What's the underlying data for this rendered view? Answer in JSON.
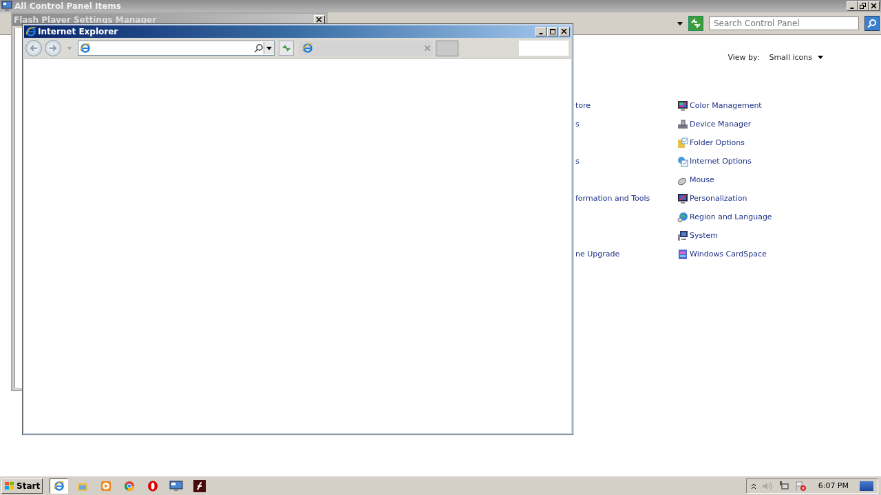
{
  "control_panel": {
    "title": "All Control Panel Items",
    "search": {
      "placeholder": "Search Control Panel"
    },
    "view_by": {
      "label": "View by:",
      "value": "Small icons"
    },
    "rows": [
      {
        "left": "tore",
        "right": {
          "label": "Color Management",
          "kind": "color"
        }
      },
      {
        "left": "s",
        "right": {
          "label": "Device Manager",
          "kind": "device"
        }
      },
      {
        "right": {
          "label": "Folder Options",
          "kind": "folder"
        }
      },
      {
        "left": "s",
        "right": {
          "label": "Internet Options",
          "kind": "internet"
        }
      },
      {
        "right": {
          "label": "Mouse",
          "kind": "mouse"
        }
      },
      {
        "left": "formation and Tools",
        "right": {
          "label": "Personalization",
          "kind": "personalization"
        }
      },
      {
        "right": {
          "label": "Region and Language",
          "kind": "region"
        }
      },
      {
        "right": {
          "label": "System",
          "kind": "system"
        }
      },
      {
        "left": "ne Upgrade",
        "right": {
          "label": "Windows CardSpace",
          "kind": "cardspace"
        }
      }
    ]
  },
  "flash_window": {
    "title": "Flash Player Settings Manager"
  },
  "ie_window": {
    "title": "Internet Explorer"
  },
  "taskbar": {
    "start": "Start",
    "buttons": [
      {
        "kind": "ie",
        "selected": true
      },
      {
        "kind": "folder",
        "selected": false
      },
      {
        "kind": "media",
        "selected": false
      },
      {
        "kind": "chrome",
        "selected": false
      },
      {
        "kind": "opera",
        "selected": false
      },
      {
        "kind": "panel",
        "selected": false
      },
      {
        "kind": "flash",
        "selected": false
      }
    ],
    "clock": "6:07 PM"
  }
}
